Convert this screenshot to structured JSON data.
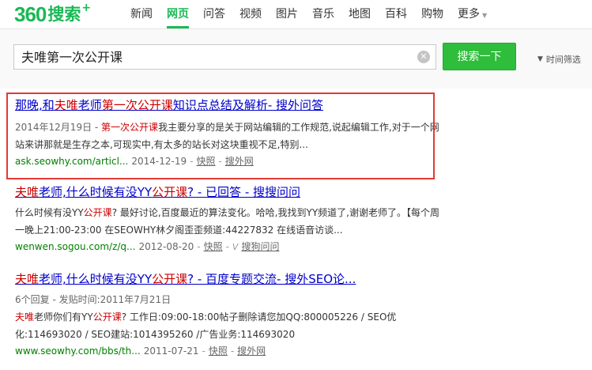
{
  "logo": {
    "number": "360",
    "text": "搜索",
    "plus": "+"
  },
  "nav": {
    "items": [
      "新闻",
      "网页",
      "问答",
      "视频",
      "图片",
      "音乐",
      "地图",
      "百科",
      "购物",
      "更多"
    ],
    "active_index": 1
  },
  "search": {
    "query": "夫唯第一次公开课",
    "button": "搜索一下",
    "filter": "时间筛选"
  },
  "results": [
    {
      "title_parts": [
        {
          "t": "那晚,和",
          "hl": false
        },
        {
          "t": "夫唯",
          "hl": true
        },
        {
          "t": "老师",
          "hl": false
        },
        {
          "t": "第一次公开课",
          "hl": true
        },
        {
          "t": "知识点总结及解析- 搜外问答",
          "hl": false
        }
      ],
      "desc_date": "2014年12月19日 - ",
      "desc_parts": [
        {
          "t": "第一次公开课",
          "hl": true
        },
        {
          "t": "我主要分享的是关于网站编辑的工作规范,说起编辑工作,对于一个网站来讲那就是生存之本,可现实中,有太多的站长对这块重视不足,特别...",
          "hl": false
        }
      ],
      "url": "ask.seowhy.com/articl...",
      "url_date": "2014-12-19",
      "links": [
        "快照",
        "搜外网"
      ]
    },
    {
      "title_parts": [
        {
          "t": "夫唯",
          "hl": true
        },
        {
          "t": "老师,什么时候有没YY",
          "hl": false
        },
        {
          "t": "公开课",
          "hl": true
        },
        {
          "t": "? - 已回答 - 搜搜问问",
          "hl": false
        }
      ],
      "desc_parts": [
        {
          "t": "什么时候有没YY",
          "hl": false
        },
        {
          "t": "公开课",
          "hl": true
        },
        {
          "t": "? 最好讨论,百度最近的算法变化。哈哈,我找到YY频道了,谢谢老师了。【每个周一晚上21:00-23:00 在SEOWHY林夕阁歪歪频道:44227832 在线语音访谈...",
          "hl": false
        }
      ],
      "url": "wenwen.sogou.com/z/q...",
      "url_date": "2012-08-20",
      "links": [
        "快照",
        "搜狗问问"
      ],
      "v_icon": "V"
    },
    {
      "title_parts": [
        {
          "t": "夫唯",
          "hl": true
        },
        {
          "t": "老师,什么时候有没YY",
          "hl": false
        },
        {
          "t": "公开课",
          "hl": true
        },
        {
          "t": "? - 百度专题交流- 搜外SEO论...",
          "hl": false
        }
      ],
      "meta": "6个回复 - 发贴时间:2011年7月21日",
      "desc_parts": [
        {
          "t": "夫唯",
          "hl": true
        },
        {
          "t": "老师你们有YY",
          "hl": false
        },
        {
          "t": "公开课",
          "hl": true
        },
        {
          "t": "? 工作日:09:00-18:00帖子删除请您加QQ:800005226 / SEO优化:114693020 / SEO建站:1014395260 /广告业务:114693020",
          "hl": false
        }
      ],
      "url": "www.seowhy.com/bbs/th...",
      "url_date": "2011-07-21",
      "links": [
        "快照",
        "搜外网"
      ]
    }
  ]
}
